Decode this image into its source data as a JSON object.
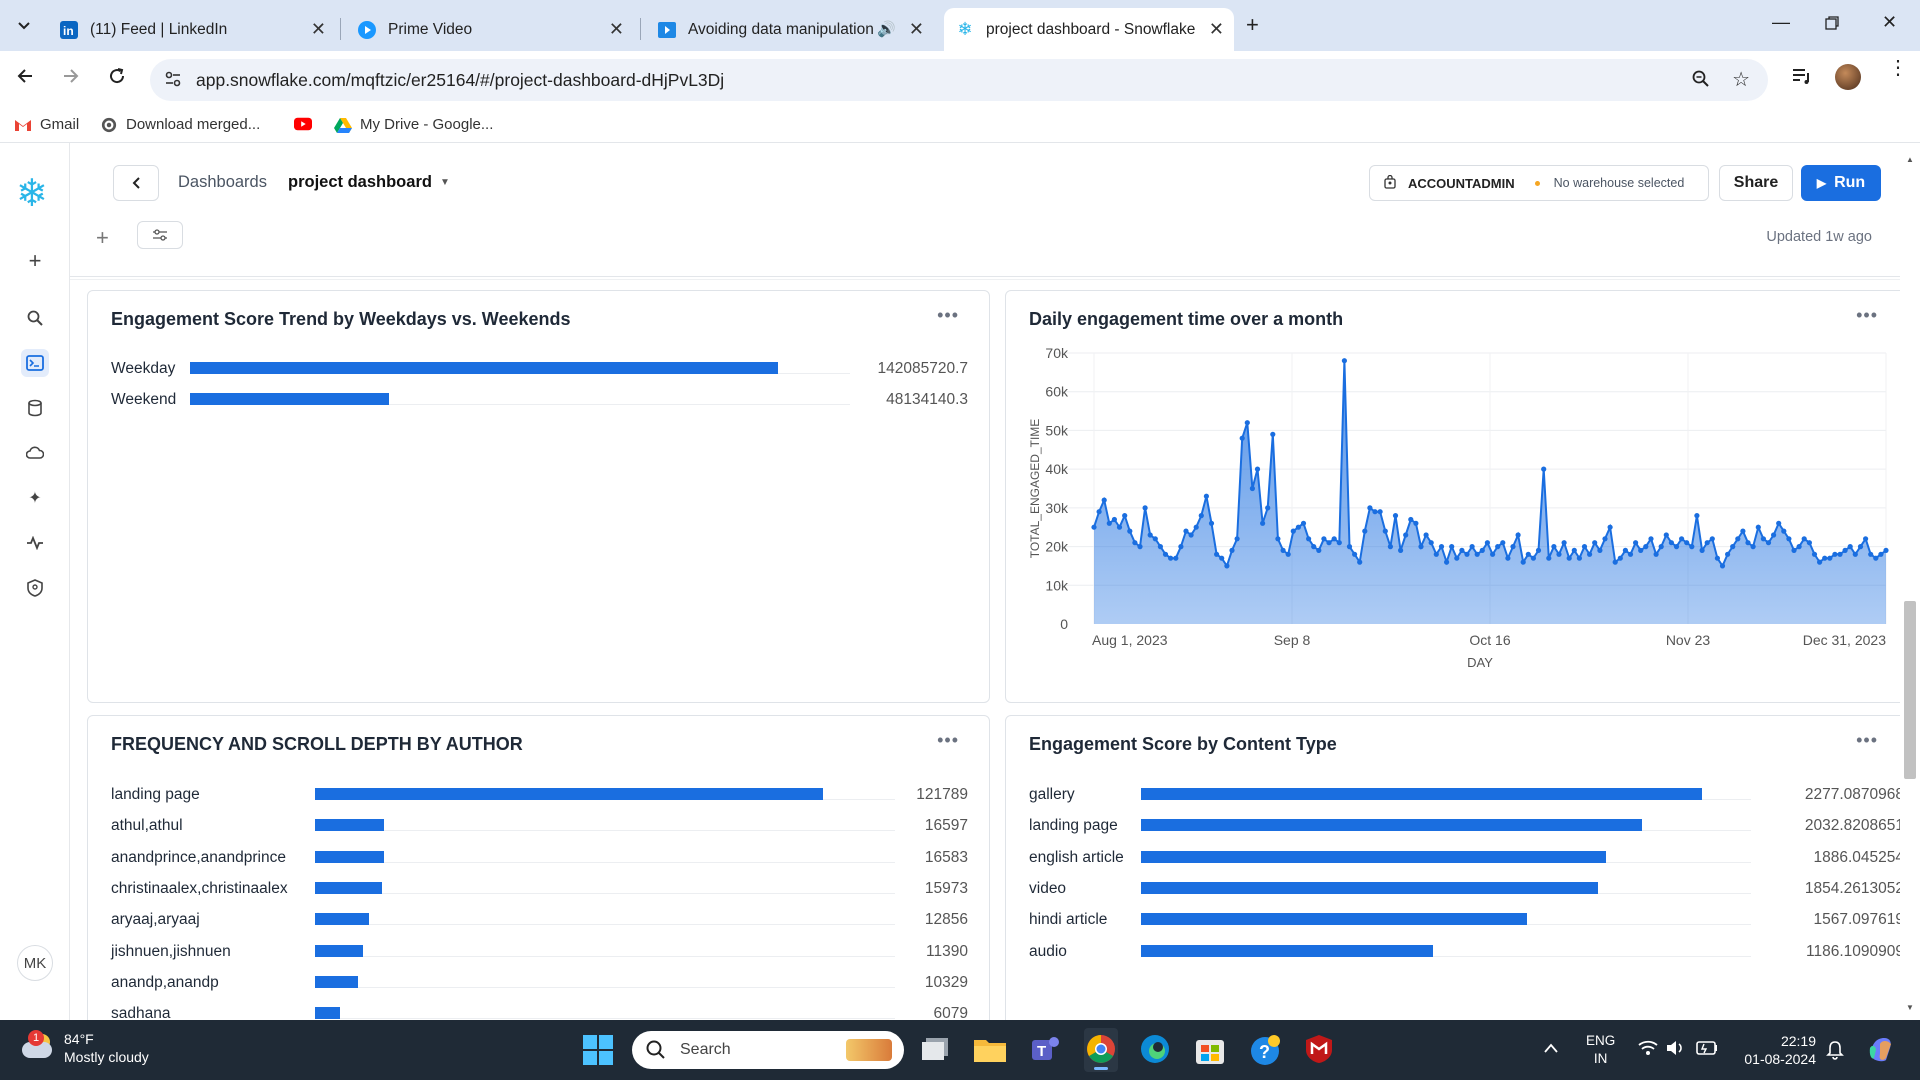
{
  "browser": {
    "tabs": [
      {
        "title": "(11) Feed | LinkedIn",
        "icon": "linkedin-icon"
      },
      {
        "title": "Prime Video",
        "icon": "prime-video-icon"
      },
      {
        "title": "Avoiding data manipulation",
        "icon": "video-icon"
      },
      {
        "title": "project dashboard - Snowflake",
        "icon": "snowflake-icon",
        "active": true
      }
    ],
    "url": "app.snowflake.com/mqftzic/er25164/#/project-dashboard-dHjPvL3Dj",
    "bookmarks": [
      {
        "label": "Gmail",
        "icon": "gmail-icon"
      },
      {
        "label": "Download merged...",
        "icon": "globe-icon"
      },
      {
        "label": "",
        "icon": "youtube-icon"
      },
      {
        "label": "My Drive - Google...",
        "icon": "google-drive-icon"
      }
    ]
  },
  "header": {
    "breadcrumb_root": "Dashboards",
    "dashboard_name": "project dashboard",
    "role": "ACCOUNTADMIN",
    "warehouse": "No warehouse selected",
    "share_label": "Share",
    "run_label": "Run",
    "updated": "Updated 1w ago"
  },
  "user_initials": "MK",
  "colors": {
    "accent": "#1a6ee0",
    "warehouse_dot": "#f5a623"
  },
  "tiles": {
    "weekday": {
      "title": "Engagement Score Trend by Weekdays vs. Weekends",
      "chart_data": {
        "type": "bar",
        "orientation": "horizontal",
        "categories": [
          "Weekday",
          "Weekend"
        ],
        "values": [
          142085720.7,
          48134140.3
        ],
        "value_labels": [
          "142085720.7",
          "48134140.3"
        ]
      }
    },
    "daily": {
      "title": "Daily engagement time over a month",
      "chart_data": {
        "type": "area",
        "xlabel": "DAY",
        "ylabel": "TOTAL_ENGAGED_TIME",
        "ylim": [
          0,
          70000
        ],
        "yticks": [
          "0",
          "10k",
          "20k",
          "30k",
          "40k",
          "50k",
          "60k",
          "70k"
        ],
        "xticks": [
          "Aug 1, 2023",
          "Sep 8",
          "Oct 16",
          "Nov 23",
          "Dec 31, 2023"
        ],
        "x_start": "2023-08-01",
        "x_end": "2023-12-31",
        "values": [
          25000,
          29000,
          32000,
          26000,
          27000,
          25000,
          28000,
          24000,
          21000,
          20000,
          30000,
          23000,
          22000,
          20000,
          18000,
          17000,
          17000,
          20000,
          24000,
          23000,
          25000,
          28000,
          33000,
          26000,
          18000,
          17000,
          15000,
          19000,
          22000,
          48000,
          52000,
          35000,
          40000,
          26000,
          30000,
          49000,
          22000,
          19000,
          18000,
          24000,
          25000,
          26000,
          22000,
          20000,
          19000,
          22000,
          21000,
          22000,
          21000,
          68000,
          20000,
          18000,
          16000,
          24000,
          30000,
          29000,
          29000,
          24000,
          20000,
          28000,
          19000,
          23000,
          27000,
          26000,
          20000,
          23000,
          21000,
          18000,
          20000,
          16000,
          20000,
          17000,
          19000,
          18000,
          20000,
          18000,
          19000,
          21000,
          18000,
          20000,
          21000,
          17000,
          20000,
          23000,
          16000,
          18000,
          17000,
          19000,
          40000,
          17000,
          20000,
          18000,
          21000,
          17000,
          19000,
          17000,
          20000,
          18000,
          21000,
          19000,
          22000,
          25000,
          16000,
          17000,
          19000,
          18000,
          21000,
          19000,
          20000,
          22000,
          18000,
          20000,
          23000,
          21000,
          20000,
          22000,
          21000,
          20000,
          28000,
          19000,
          21000,
          22000,
          17000,
          15000,
          18000,
          20000,
          22000,
          24000,
          21000,
          20000,
          25000,
          22000,
          21000,
          23000,
          26000,
          24000,
          22000,
          19000,
          20000,
          22000,
          21000,
          18000,
          16000,
          17000,
          17000,
          18000,
          18000,
          19000,
          20000,
          18000,
          20000,
          22000,
          18000,
          17000,
          18000,
          19000
        ]
      }
    },
    "author": {
      "title": "FREQUENCY AND SCROLL DEPTH BY AUTHOR",
      "chart_data": {
        "type": "bar",
        "orientation": "horizontal",
        "categories": [
          "landing page",
          "athul,athul",
          "anandprince,anandprince",
          "christinaalex,christinaalex",
          "aryaaj,aryaaj",
          "jishnuen,jishnuen",
          "anandp,anandp",
          "sadhana"
        ],
        "values": [
          121789,
          16597,
          16583,
          15973,
          12856,
          11390,
          10329,
          6079
        ],
        "value_labels": [
          "121789",
          "16597",
          "16583",
          "15973",
          "12856",
          "11390",
          "10329",
          "6079"
        ]
      }
    },
    "content": {
      "title": "Engagement Score by Content Type",
      "chart_data": {
        "type": "bar",
        "orientation": "horizontal",
        "categories": [
          "gallery",
          "landing page",
          "english article",
          "video",
          "hindi article",
          "audio"
        ],
        "values": [
          2277.0870968,
          2032.8208651,
          1886.045254,
          1854.2613052,
          1567.097619,
          1186.1090909
        ],
        "value_labels": [
          "2277.0870968",
          "2032.8208651",
          "1886.045254",
          "1854.2613052",
          "1567.097619",
          "1186.1090909"
        ]
      }
    }
  },
  "taskbar": {
    "temp": "84°F",
    "weather": "Mostly cloudy",
    "weather_badge": "1",
    "search": "Search",
    "lang1": "ENG",
    "lang2": "IN",
    "time": "22:19",
    "date": "01-08-2024"
  }
}
